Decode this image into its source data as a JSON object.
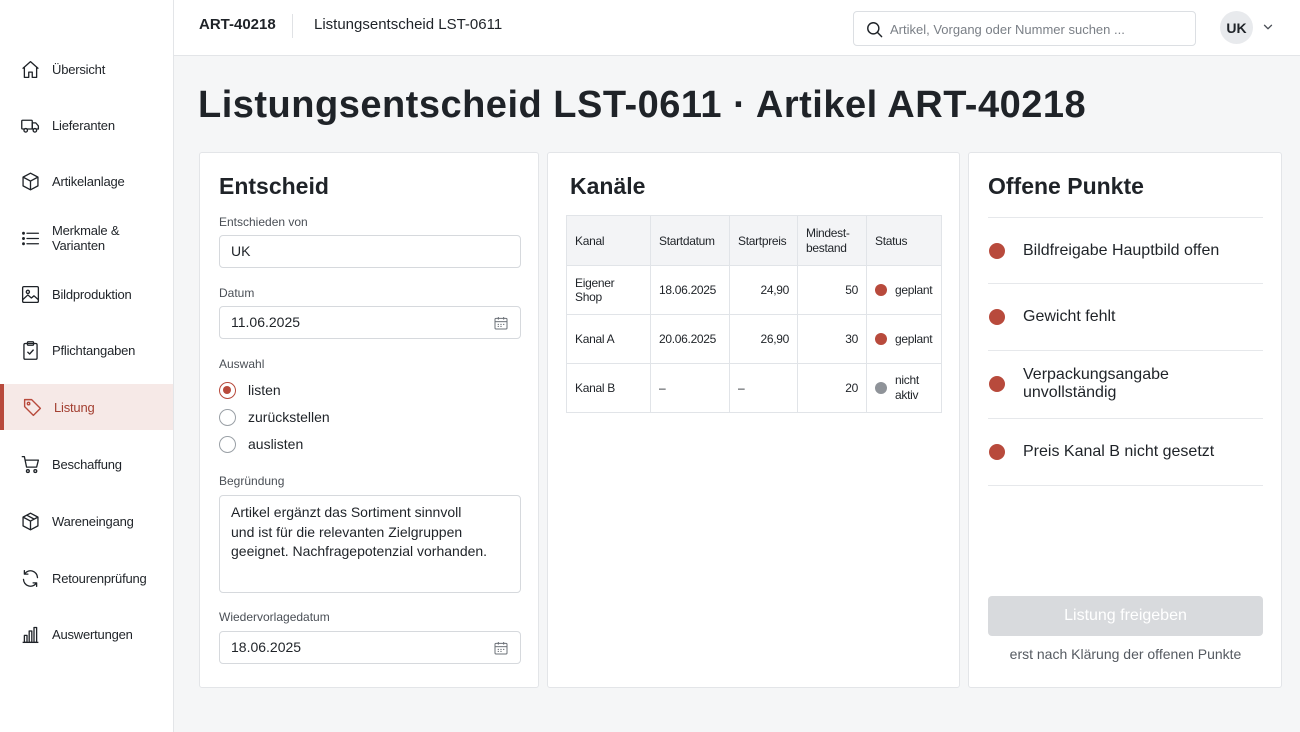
{
  "header": {
    "breadcrumb_id": "ART-40218",
    "breadcrumb_doc": "Listungsentscheid LST-0611",
    "search_placeholder": "Artikel, Vorgang oder Nummer suchen ...",
    "user_initials": "UK"
  },
  "sidebar": {
    "items": [
      {
        "label": "Übersicht",
        "icon": "home-icon"
      },
      {
        "label": "Lieferanten",
        "icon": "truck-icon"
      },
      {
        "label": "Artikelanlage",
        "icon": "box-icon"
      },
      {
        "label": "Merkmale & Varianten",
        "icon": "list-icon"
      },
      {
        "label": "Bildproduktion",
        "icon": "image-icon"
      },
      {
        "label": "Pflichtangaben",
        "icon": "clipboard-check-icon"
      },
      {
        "label": "Listung",
        "icon": "tag-icon",
        "active": true
      },
      {
        "label": "Beschaffung",
        "icon": "cart-icon"
      },
      {
        "label": "Wareneingang",
        "icon": "package-icon"
      },
      {
        "label": "Retourenprüfung",
        "icon": "refresh-icon"
      },
      {
        "label": "Auswertungen",
        "icon": "bar-chart-icon"
      }
    ]
  },
  "page_title": "Listungsentscheid LST-0611 · Artikel ART-40218",
  "entscheid": {
    "title": "Entscheid",
    "decided_by_label": "Entschieden von",
    "decided_by_value": "UK",
    "date_label": "Datum",
    "date_value": "11.06.2025",
    "choice_label": "Auswahl",
    "options": [
      "listen",
      "zurückstellen",
      "auslisten"
    ],
    "selected_option": "listen",
    "reason_label": "Begründung",
    "reason_lines": [
      "Artikel ergänzt das Sortiment sinnvoll",
      "und ist für die relevanten Zielgruppen",
      "geeignet. Nachfragepotenzial vorhanden."
    ],
    "followup_label": "Wiedervorlagedatum",
    "followup_value": "18.06.2025"
  },
  "kanaele": {
    "title": "Kanäle",
    "headers": [
      "Kanal",
      "Startdatum",
      "Startpreis",
      "Mindest-\nbestand",
      "Status"
    ],
    "rows": [
      {
        "kanal": "Eigener Shop",
        "start": "18.06.2025",
        "preis": "24,90",
        "bestand": "50",
        "status": "geplant",
        "status_color": "#b84a3c"
      },
      {
        "kanal": "Kanal A",
        "start": "20.06.2025",
        "preis": "26,90",
        "bestand": "30",
        "status": "geplant",
        "status_color": "#b84a3c"
      },
      {
        "kanal": "Kanal B",
        "start": "–",
        "preis": "–",
        "bestand": "20",
        "status": "nicht\naktiv",
        "status_color": "#8f9399"
      }
    ]
  },
  "offene_punkte": {
    "title": "Offene Punkte",
    "items": [
      "Bildfreigabe Hauptbild offen",
      "Gewicht fehlt",
      "Verpackungsangabe unvollständig",
      "Preis Kanal B nicht gesetzt"
    ],
    "button_label": "Listung freigeben",
    "button_note": "erst nach Klärung der offenen Punkte"
  },
  "colors": {
    "accent": "#b84a3c",
    "inactive": "#8f9399"
  }
}
